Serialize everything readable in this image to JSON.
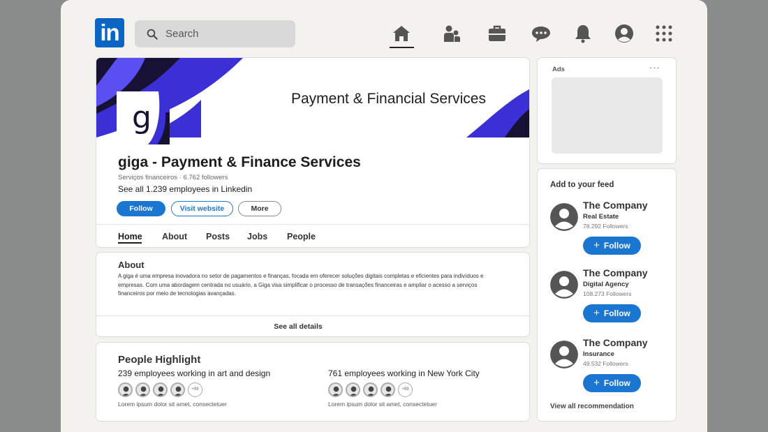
{
  "nav": {
    "logo_text": "in",
    "search_placeholder": "Search",
    "icons": [
      "home-icon",
      "network-icon",
      "jobs-icon",
      "messaging-icon",
      "notifications-icon",
      "profile-icon",
      "apps-grid-icon"
    ]
  },
  "colors": {
    "brand_blue": "#0a66c2",
    "button_blue": "#1b76d2",
    "banner_purple": "#3b2fd6",
    "banner_dark": "#171233"
  },
  "company": {
    "banner_tagline": "Payment & Financial Services",
    "logo_letter": "g",
    "name": "giga - Payment & Finance Services",
    "meta": "Serviços financeiros · 6.762 followers",
    "employees_link": "See all 1.239 employees in Linkedin",
    "buttons": {
      "follow": "Follow",
      "visit": "Visit website",
      "more": "More"
    },
    "tabs": [
      "Home",
      "About",
      "Posts",
      "Jobs",
      "People"
    ]
  },
  "about": {
    "title": "About",
    "text": "A giga é uma empresa inovadora no setor de pagamentos e finanças, focada em oferecer soluções digitais completas e eficientes para indivíduos e empresas. Com uma abordagem centrada no usuário, a Giga visa simplificar o processo de transações financeiras e ampliar o acesso a serviços financeiros por meio de tecnologias avançadas.",
    "see_all": "See all details"
  },
  "people": {
    "title": "People Highlight",
    "groups": [
      {
        "heading": "239 employees working in art and design",
        "more": "+99",
        "sub": "Lorem ipsum dolor sit amet, consectetuer"
      },
      {
        "heading": "761 employees working in New York City",
        "more": "+99",
        "sub": "Lorem ipsum dolor sit amet, consectetuer"
      }
    ]
  },
  "ads": {
    "label": "Ads",
    "menu": "···"
  },
  "feed": {
    "title": "Add to your feed",
    "recommendations": [
      {
        "name": "The Company",
        "category": "Real Estate",
        "followers": "78.292 Followers",
        "button": "Follow"
      },
      {
        "name": "The Company",
        "category": "Digital Agency",
        "followers": "108.273 Followers",
        "button": "Follow"
      },
      {
        "name": "The Company",
        "category": "Insurance",
        "followers": "49.532 Followers",
        "button": "Follow"
      }
    ],
    "view_all": "View all recommendation"
  }
}
